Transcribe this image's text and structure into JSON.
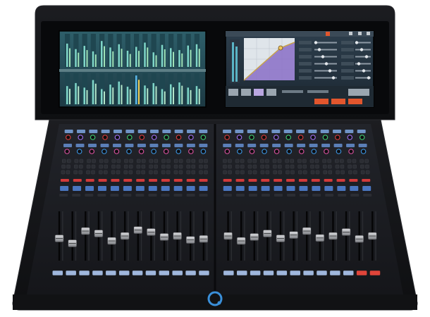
{
  "product": {
    "kind": "digital audio mixing console",
    "colors": {
      "chassis": "#141416",
      "bezel": "#0b0b0d",
      "surface": "#1b1c20",
      "accent_blue": "#3a8fd9",
      "led_red": "#d23a3a",
      "led_green": "#3ec46d",
      "lcd_teal": "#7fd6c8"
    }
  },
  "screens": {
    "left": {
      "view": "meters",
      "meter_count": 16,
      "levels_top": [
        0.72,
        0.55,
        0.65,
        0.48,
        0.8,
        0.6,
        0.7,
        0.5,
        0.62,
        0.75,
        0.45,
        0.68,
        0.58,
        0.52,
        0.66,
        0.7
      ],
      "levels_bottom": [
        0.6,
        0.7,
        0.55,
        0.8,
        0.5,
        0.65,
        0.75,
        0.58,
        0.95,
        0.62,
        0.7,
        0.5,
        0.66,
        0.72,
        0.55,
        0.6
      ]
    },
    "right": {
      "view": "dynamics",
      "graph_icon": "compressor-curve-icon",
      "fader_rows": 6
    }
  },
  "surface": {
    "bays": [
      {
        "name": "left-bay",
        "strips": 12,
        "fader_levels": [
          0.45,
          0.35,
          0.6,
          0.55,
          0.4,
          0.5,
          0.62,
          0.58,
          0.48,
          0.5,
          0.42,
          0.44
        ]
      },
      {
        "name": "right-bay",
        "strips": 12,
        "fader_levels": [
          0.5,
          0.4,
          0.48,
          0.55,
          0.45,
          0.52,
          0.6,
          0.46,
          0.5,
          0.58,
          0.44,
          0.5
        ]
      }
    ],
    "select_keys_red": [
      22,
      23
    ]
  },
  "logo": {
    "icon": "brand-logo-icon"
  }
}
